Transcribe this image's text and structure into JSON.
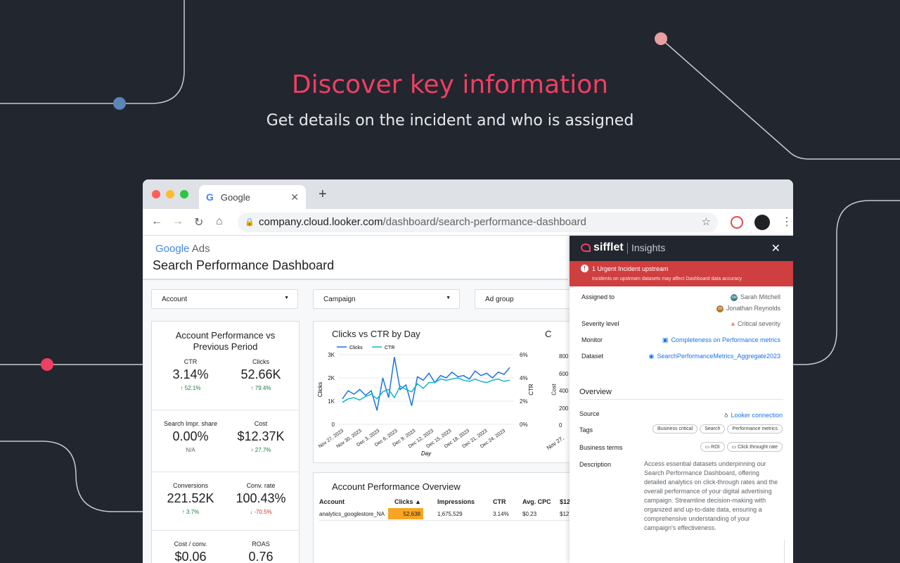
{
  "hero": {
    "title": "Discover key information",
    "subtitle": "Get details on the incident and who is assigned"
  },
  "browser": {
    "tab_title": "Google",
    "tab_icon": "G",
    "url_domain": "company.cloud.looker.com",
    "url_path": "/dashboard/search-performance-dashboard"
  },
  "dashboard": {
    "brand_google": "Google",
    "brand_ads": "Ads",
    "title": "Search Performance Dashboard",
    "filters": [
      "Account",
      "Campaign",
      "Ad group"
    ],
    "kpi_card_title": "Account Performance vs Previous Period",
    "kpis": [
      {
        "label": "CTR",
        "value": "3.14%",
        "change": "↑ 52.1%",
        "dir": "up"
      },
      {
        "label": "Clicks",
        "value": "52.66K",
        "change": "↑ 79.4%",
        "dir": "up"
      },
      {
        "label": "Search Impr. share",
        "value": "0.00%",
        "change": "N/A",
        "dir": "neu"
      },
      {
        "label": "Cost",
        "value": "$12.37K",
        "change": "↑ 27.7%",
        "dir": "up"
      },
      {
        "label": "Conversions",
        "value": "221.52K",
        "change": "↑ 3.7%",
        "dir": "up"
      },
      {
        "label": "Conv. rate",
        "value": "100.43%",
        "change": "↓ -70.5%",
        "dir": "down"
      },
      {
        "label": "Cost / conv.",
        "value": "$0.06",
        "change": "",
        "dir": "neu"
      },
      {
        "label": "ROAS",
        "value": "0.76",
        "change": "",
        "dir": "neu"
      }
    ],
    "chart2_partial_title": "C",
    "chart2_partial_ylabel": "Cost",
    "chart2_partial_ticks": [
      "800",
      "600",
      "400",
      "200",
      "0"
    ],
    "chart2_partial_xtick": "Nov 27,",
    "table": {
      "title": "Account Performance Overview",
      "headers": [
        "Account",
        "Clicks ▲",
        "Impressions",
        "CTR",
        "Avg. CPC",
        "$12"
      ],
      "row": [
        "analytics_googlestore_NA",
        "52,638",
        "1,675,529",
        "3.14%",
        "$0.23",
        "$12"
      ]
    }
  },
  "chart_data": {
    "type": "line",
    "title": "Clicks vs CTR by Day",
    "xlabel": "Day",
    "ylabel": "Clicks",
    "y2label": "CTR",
    "x_ticks": [
      "Nov 27, 2023",
      "Nov 30, 2023",
      "Dec 3, 2023",
      "Dec 6, 2023",
      "Dec 9, 2023",
      "Dec 12, 2023",
      "Dec 15, 2023",
      "Dec 18, 2023",
      "Dec 21, 2023",
      "Dec 24, 2023"
    ],
    "y_ticks": [
      "0",
      "1K",
      "2K",
      "3K"
    ],
    "y2_ticks": [
      "0%",
      "2%",
      "4%",
      "6%"
    ],
    "ylim": [
      0,
      3000
    ],
    "y2lim": [
      0,
      6
    ],
    "series": [
      {
        "name": "Clicks",
        "axis": "left",
        "color": "#1a73e8",
        "values": [
          1100,
          1450,
          1300,
          1500,
          1250,
          1450,
          600,
          2000,
          1150,
          2900,
          1500,
          1700,
          800,
          2050,
          1900,
          2200,
          1800,
          2100,
          2000,
          2250,
          2050,
          2100,
          1950,
          2300,
          2100,
          2200,
          2000,
          2250,
          2150,
          2450
        ]
      },
      {
        "name": "CTR",
        "axis": "right",
        "color": "#12b5cb",
        "values": [
          1.9,
          2.2,
          2.3,
          2.1,
          2.4,
          2.6,
          2.2,
          2.8,
          3.0,
          2.3,
          3.3,
          3.0,
          2.8,
          3.5,
          3.1,
          3.6,
          3.6,
          3.9,
          3.8,
          3.9,
          4.0,
          3.8,
          3.7,
          3.9,
          3.7,
          3.6,
          3.8,
          3.9,
          3.7,
          3.8
        ]
      }
    ],
    "legend": "top-left",
    "grid": true
  },
  "panel": {
    "brand": "sifflet",
    "section_name": "Insights",
    "alert_title": "1 Urgent Incident upstream",
    "alert_detail": "Incidents on upstream datasets may affect Dashboard data accuracy",
    "assigned_label": "Assigned to",
    "assignees": [
      {
        "initials": "SM",
        "name": "Sarah Mitchell",
        "color": "#3a7d8c"
      },
      {
        "initials": "JR",
        "name": "Jonathan Reynolds",
        "color": "#b0782c"
      }
    ],
    "severity_label": "Severity level",
    "severity_value": "Critical severity",
    "monitor_label": "Monitor",
    "monitor_value": "Completeness on Performance metrics",
    "dataset_label": "Dataset",
    "dataset_value": "SearchPerformanceMetrics_Aggregate2023",
    "overview_title": "Overview",
    "source_label": "Source",
    "source_value": "Looker connection",
    "tags_label": "Tags",
    "tags": [
      "Business critical",
      "Search",
      "Performance metrics"
    ],
    "terms_label": "Business terms",
    "terms": [
      "ROI",
      "Click throught rate"
    ],
    "description_label": "Description",
    "description": "Access essential datasets underpinning our Search Performance Dashboard, offering detailed analytics on click-through rates and the overall performance of your digital advertising campaign. Streamline decision-making with organized and up-to-date data, ensuring a comprehensive understanding of your campaign's effectiveness."
  }
}
